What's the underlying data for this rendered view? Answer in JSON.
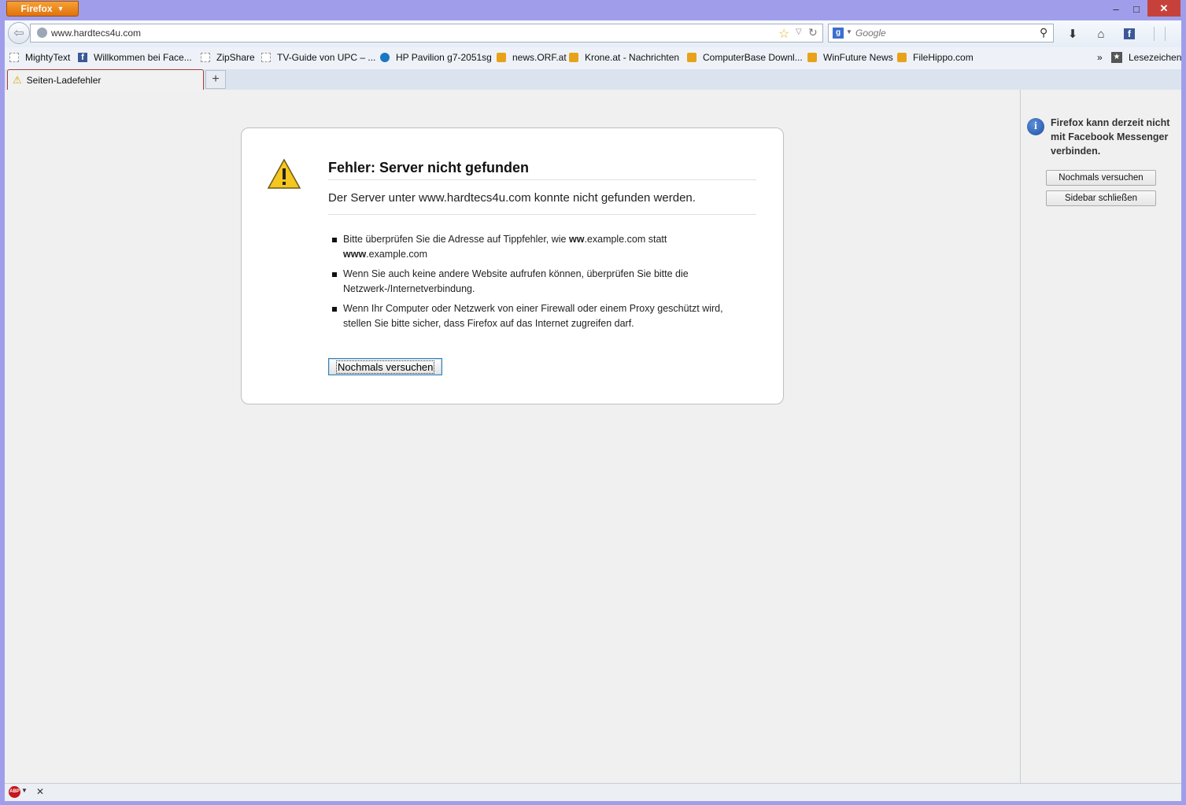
{
  "titlebar": {
    "app_button": "Firefox",
    "minimize": "–",
    "maximize": "□",
    "close": "✕"
  },
  "navbar": {
    "url": "www.hardtecs4u.com",
    "search_placeholder": "Google",
    "search_engine_letter": "g",
    "facebook_letter": "f"
  },
  "bookmarks": {
    "items": [
      {
        "label": "MightyText",
        "icon": "blank-page-icon"
      },
      {
        "label": "Willkommen bei Face...",
        "icon": "facebook-icon"
      },
      {
        "label": "ZipShare",
        "icon": "blank-page-icon"
      },
      {
        "label": "TV-Guide von UPC – ...",
        "icon": "blank-page-icon"
      },
      {
        "label": "HP Pavilion g7-2051sg",
        "icon": "hp-icon"
      },
      {
        "label": "news.ORF.at",
        "icon": "rss-icon"
      },
      {
        "label": "Krone.at - Nachrichten",
        "icon": "rss-icon"
      },
      {
        "label": "ComputerBase Downl...",
        "icon": "rss-icon"
      },
      {
        "label": "WinFuture News",
        "icon": "rss-icon"
      },
      {
        "label": "FileHippo.com",
        "icon": "rss-icon"
      }
    ],
    "more": "»",
    "lesezeichen": "Lesezeichen"
  },
  "tabs": {
    "active_label": "Seiten-Ladefehler",
    "new_tab": "+"
  },
  "error": {
    "title": "Fehler: Server nicht gefunden",
    "description": "Der Server unter www.hardtecs4u.com konnte nicht gefunden werden.",
    "tips": {
      "tip1_a": "Bitte überprüfen Sie die Adresse auf Tippfehler, wie ",
      "tip1_b": "ww",
      "tip1_c": ".example.com statt ",
      "tip1_d": "www",
      "tip1_e": ".example.com",
      "tip2": "Wenn Sie auch keine andere Website aufrufen können, überprüfen Sie bitte die Netzwerk-/Internetverbindung.",
      "tip3": "Wenn Ihr Computer oder Netzwerk von einer Firewall oder einem Proxy geschützt wird, stellen Sie bitte sicher, dass Firefox auf das Internet zugreifen darf."
    },
    "retry_button": "Nochmals versuchen"
  },
  "sidebar": {
    "info_letter": "i",
    "message": "Firefox kann derzeit nicht mit Facebook Messenger verbinden.",
    "retry_button": "Nochmals versuchen",
    "close_button": "Sidebar schließen"
  },
  "statusbar": {
    "abp_label": "ABP",
    "close": "✕"
  },
  "colors": {
    "window_frame": "#a09eea",
    "firefox_button": "#e0720f",
    "close_button": "#c7413b",
    "content_bg": "#f0f0f0"
  }
}
